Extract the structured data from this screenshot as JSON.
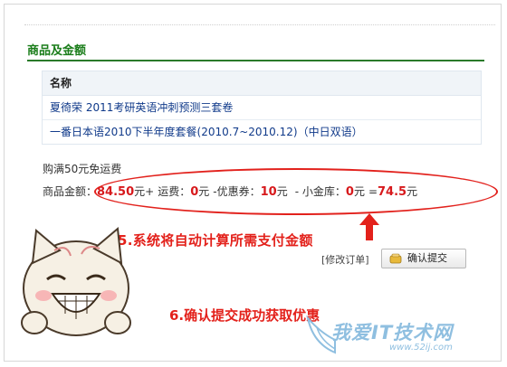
{
  "section_title": "商品及金额",
  "table": {
    "header": "名称",
    "rows": [
      "夏徛荣  2011考研英语冲刺预测三套卷",
      "一番日本语2010下半年度套餐(2010.7~2010.12)（中日双语）"
    ]
  },
  "free_shipping": "购满50元免运费",
  "totals": {
    "goods_label": "商品金额：",
    "goods_value": "84.50",
    "goods_unit": "元+",
    "shipping_label": "运费：",
    "shipping_value": "0",
    "shipping_unit": "元",
    "coupon_label": "-优惠券：",
    "coupon_value": "10",
    "coupon_unit": "元",
    "vault_label": "- 小金库：",
    "vault_value": "0",
    "vault_unit": "元",
    "equals": "=",
    "total_value": "74.5",
    "total_unit": "元"
  },
  "annotation_5": "5.系统将自动计算所需支付金额",
  "modify_order": "[修改订单]",
  "confirm_button": "确认提交",
  "annotation_6": "6.确认提交成功获取优惠",
  "watermark": "我爱IT技术网",
  "watermark_url": "www.52ij.com",
  "colors": {
    "accent_red": "#e3211b",
    "title_green": "#1a7d1a",
    "link_blue": "#103a8a"
  }
}
